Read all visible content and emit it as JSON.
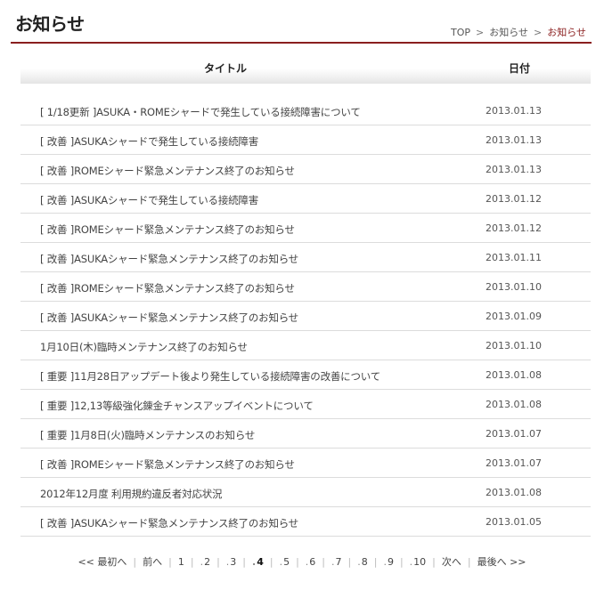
{
  "page": {
    "title": "お知らせ"
  },
  "breadcrumb": {
    "items": [
      "TOP",
      "お知らせ",
      "お知らせ"
    ],
    "separator": ">"
  },
  "table": {
    "headers": {
      "title": "タイトル",
      "date": "日付"
    },
    "rows": [
      {
        "title": "[ 1/18更新 ]ASUKA・ROMEシャードで発生している接続障害について",
        "date": "2013.01.13"
      },
      {
        "title": "[ 改善 ]ASUKAシャードで発生している接続障害",
        "date": "2013.01.13"
      },
      {
        "title": "[ 改善 ]ROMEシャード緊急メンテナンス終了のお知らせ",
        "date": "2013.01.13"
      },
      {
        "title": "[ 改善 ]ASUKAシャードで発生している接続障害",
        "date": "2013.01.12"
      },
      {
        "title": "[ 改善 ]ROMEシャード緊急メンテナンス終了のお知らせ",
        "date": "2013.01.12"
      },
      {
        "title": "[ 改善 ]ASUKAシャード緊急メンテナンス終了のお知らせ",
        "date": "2013.01.11"
      },
      {
        "title": "[ 改善 ]ROMEシャード緊急メンテナンス終了のお知らせ",
        "date": "2013.01.10"
      },
      {
        "title": "[ 改善 ]ASUKAシャード緊急メンテナンス終了のお知らせ",
        "date": "2013.01.09"
      },
      {
        "title": "1月10日(木)臨時メンテナンス終了のお知らせ",
        "date": "2013.01.10"
      },
      {
        "title": "[ 重要 ]11月28日アップデート後より発生している接続障害の改善について",
        "date": "2013.01.08"
      },
      {
        "title": "[ 重要 ]12,13等級強化錬金チャンスアップイベントについて",
        "date": "2013.01.08"
      },
      {
        "title": "[ 重要 ]1月8日(火)臨時メンテナンスのお知らせ",
        "date": "2013.01.07"
      },
      {
        "title": "[ 改善 ]ROMEシャード緊急メンテナンス終了のお知らせ",
        "date": "2013.01.07"
      },
      {
        "title": "2012年12月度 利用規約違反者対応状況",
        "date": "2013.01.08"
      },
      {
        "title": "[ 改善 ]ASUKAシャード緊急メンテナンス終了のお知らせ",
        "date": "2013.01.05"
      }
    ]
  },
  "pagination": {
    "first": "<< 最初へ",
    "prev": "前へ",
    "pages": [
      "1",
      "2",
      "3",
      "4",
      "5",
      "6",
      "7",
      "8",
      "9",
      "10"
    ],
    "current_page": "4",
    "next": "次へ",
    "last": "最後へ >>"
  },
  "colors": {
    "accent": "#8a1e1e",
    "row_divider": "#dcdcdc",
    "text": "#444444"
  }
}
